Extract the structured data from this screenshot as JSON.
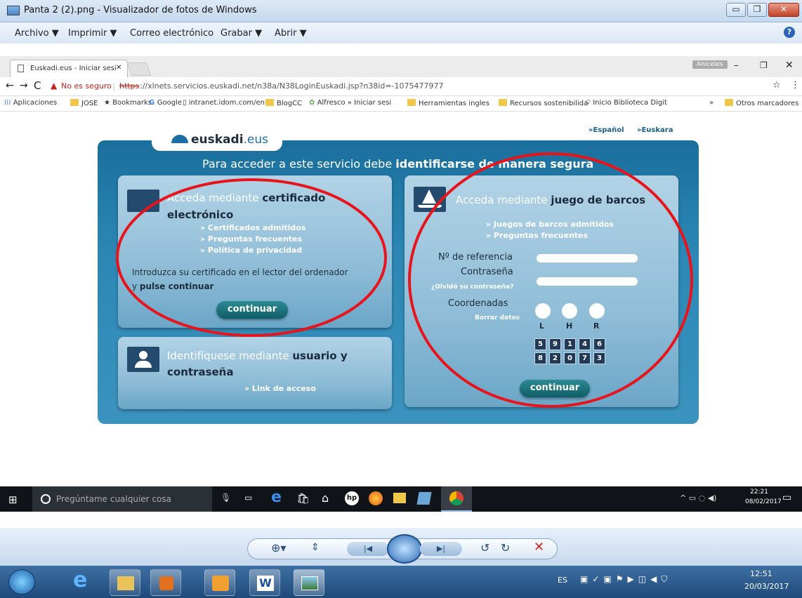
{
  "window": {
    "title": "Panta 2 (2).png - Visualizador de fotos de Windows",
    "menu": [
      "Archivo ▼",
      "Imprimir ▼",
      "Correo electrónico",
      "Grabar ▼",
      "Abrir ▼"
    ]
  },
  "browser": {
    "tab_title": "Euskadi.eus - Iniciar sesi",
    "profile": "Aniceles",
    "security": "No es seguro",
    "url_scheme": "https",
    "url_rest": "://xlnets.servicios.euskadi.net/n38a/N38LoginEuskadi.jsp?n38id=-1075477977",
    "bookmarks": [
      "Aplicaciones",
      "JOSE",
      "Bookmarks",
      "Google",
      "intranet.idom.com/en",
      "BlogCC",
      "Alfresco » Iniciar sesi",
      "Herramientas ingles",
      "Recursos sostenibilida",
      "Inicio Biblioteca Digit"
    ],
    "more": "»",
    "other_bookmarks": "Otros marcadores"
  },
  "page": {
    "logo_main": "euskadi",
    "logo_suffix": ".eus",
    "lang_es": "»Español",
    "lang_eu": "»Euskara",
    "banner_prefix": "Para acceder a este servicio debe ",
    "banner_bold": "identificarse de manera segura",
    "cert": {
      "title_prefix": "Acceda mediante ",
      "title_bold": "certificado",
      "title_bold2": "electrónico",
      "links": [
        "» Certificados admitidos",
        "» Preguntas frecuentes",
        "» Política de privacidad"
      ],
      "instr1": "Introduzca su certificado en el lector del ordenador",
      "instr2_prefix": "y ",
      "instr2_bold": "pulse continuar",
      "button": "continuar"
    },
    "user": {
      "title_prefix": "Identifíquese mediante ",
      "title_bold": "usuario y",
      "title_bold2": "contraseña",
      "link": "» Link de acceso"
    },
    "boats": {
      "title_prefix": "Acceda mediante ",
      "title_bold": "juego de barcos",
      "links": [
        "» Juegos de barcos admitidos",
        "» Preguntas frecuentes"
      ],
      "ref_label": "Nº de referencia",
      "pwd_label": "Contraseña",
      "forgot": "¿Olvidó su contraseña?",
      "coord_label": "Coordenadas",
      "clear": "Borrar datos",
      "letters": [
        "L",
        "H",
        "R"
      ],
      "keypad": [
        [
          "5",
          "9",
          "1",
          "4",
          "6"
        ],
        [
          "8",
          "2",
          "0",
          "7",
          "3"
        ]
      ],
      "button": "continuar"
    }
  },
  "win10": {
    "search": "Pregúntame cualquier cosa",
    "time": "22:21",
    "date": "08/02/2017"
  },
  "win7": {
    "lang": "ES",
    "time": "12:51",
    "date": "20/03/2017"
  },
  "colors": {
    "annotation": "#e8141b",
    "portal": "#1f76a4",
    "button": "#17707a"
  }
}
